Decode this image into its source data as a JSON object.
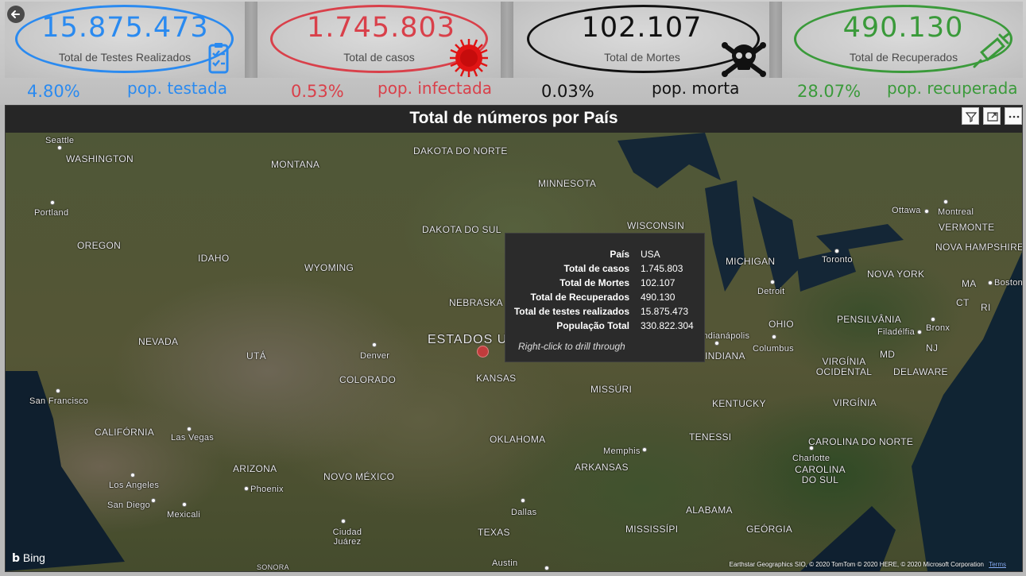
{
  "colors": {
    "testes": "#2a8af0",
    "casos": "#d9404a",
    "mortes": "#111111",
    "recuperados": "#3a9a3a",
    "tooltip_bg": "#2b2b2b",
    "bubble": "#c13c3c"
  },
  "icons": {
    "back": "back-arrow-icon",
    "testes": "clipboard-checklist-icon",
    "casos": "virus-icon",
    "mortes": "skull-crossbones-icon",
    "recuperados": "syringe-icon",
    "filter": "filter-icon",
    "focus": "focus-mode-icon",
    "more": "more-options-icon"
  },
  "kpis": {
    "testes": {
      "value": "15.875.473",
      "label": "Total de Testes Realizados",
      "pct": "4.80%",
      "pct_label": "pop. testada"
    },
    "casos": {
      "value": "1.745.803",
      "label": "Total de casos",
      "pct": "0.53%",
      "pct_label": "pop. infectada"
    },
    "mortes": {
      "value": "102.107",
      "label": "Total de Mortes",
      "pct": "0.03%",
      "pct_label": "pop. morta"
    },
    "recuperados": {
      "value": "490.130",
      "label": "Total de Recuperados",
      "pct": "28.07%",
      "pct_label": "pop. recuperada"
    }
  },
  "map_visual": {
    "title": "Total de números por País",
    "country_label": "ESTADOS U",
    "states": [
      "WASHINGTON",
      "MONTANA",
      "DAKOTA DO NORTE",
      "MINNESOTA",
      "WISCONSIN",
      "OREGON",
      "IDAHO",
      "DAKOTA DO SUL",
      "WYOMING",
      "MICHIGAN",
      "NEBRASKA",
      "NEVADA",
      "UTÁ",
      "COLORADO",
      "KANSAS",
      "OHIO",
      "INDIANA",
      "MISSÚRI",
      "KENTUCKY",
      "VIRGÍNIA OCIDENTAL",
      "VIRGÍNIA",
      "CALIFÓRNIA",
      "ARIZONA",
      "NOVO MÉXICO",
      "OKLAHOMA",
      "ARKANSAS",
      "TENESSI",
      "CAROLINA DO NORTE",
      "CAROLINA DO SUL",
      "ALABAMA",
      "MISSISSÍPI",
      "GEÓRGIA",
      "TEXAS",
      "SONORA",
      "PENSILVÂNIA",
      "NOVA YORK",
      "VERMONTE",
      "NOVA HAMPSHIRE",
      "MA",
      "CT",
      "RI",
      "NJ",
      "MD",
      "DELAWARE"
    ],
    "cities": [
      "Seattle",
      "Portland",
      "San Francisco",
      "Las Vegas",
      "Los Angeles",
      "San Diego",
      "Mexicali",
      "Phoenix",
      "Ciudad Juárez",
      "Denver",
      "Dallas",
      "Austin",
      "Memphis",
      "Charlotte",
      "Columbus",
      "Indianápolis",
      "Detroit",
      "Toronto",
      "Ottawa",
      "Montreal",
      "Boston",
      "Filadélfia",
      "Bronx"
    ],
    "tooltip": {
      "rows": [
        {
          "k": "País",
          "v": "USA"
        },
        {
          "k": "Total de casos",
          "v": "1.745.803"
        },
        {
          "k": "Total de Mortes",
          "v": "102.107"
        },
        {
          "k": "Total de Recuperados",
          "v": "490.130"
        },
        {
          "k": "Total de testes realizados",
          "v": "15.875.473"
        },
        {
          "k": "População Total",
          "v": "330.822.304"
        }
      ],
      "hint": "Right-click to drill through"
    },
    "bing": "Bing",
    "copyright": "Earthstar Geographics SIO, © 2020 TomTom © 2020 HERE, © 2020 Microsoft Corporation",
    "terms": "Terms"
  }
}
